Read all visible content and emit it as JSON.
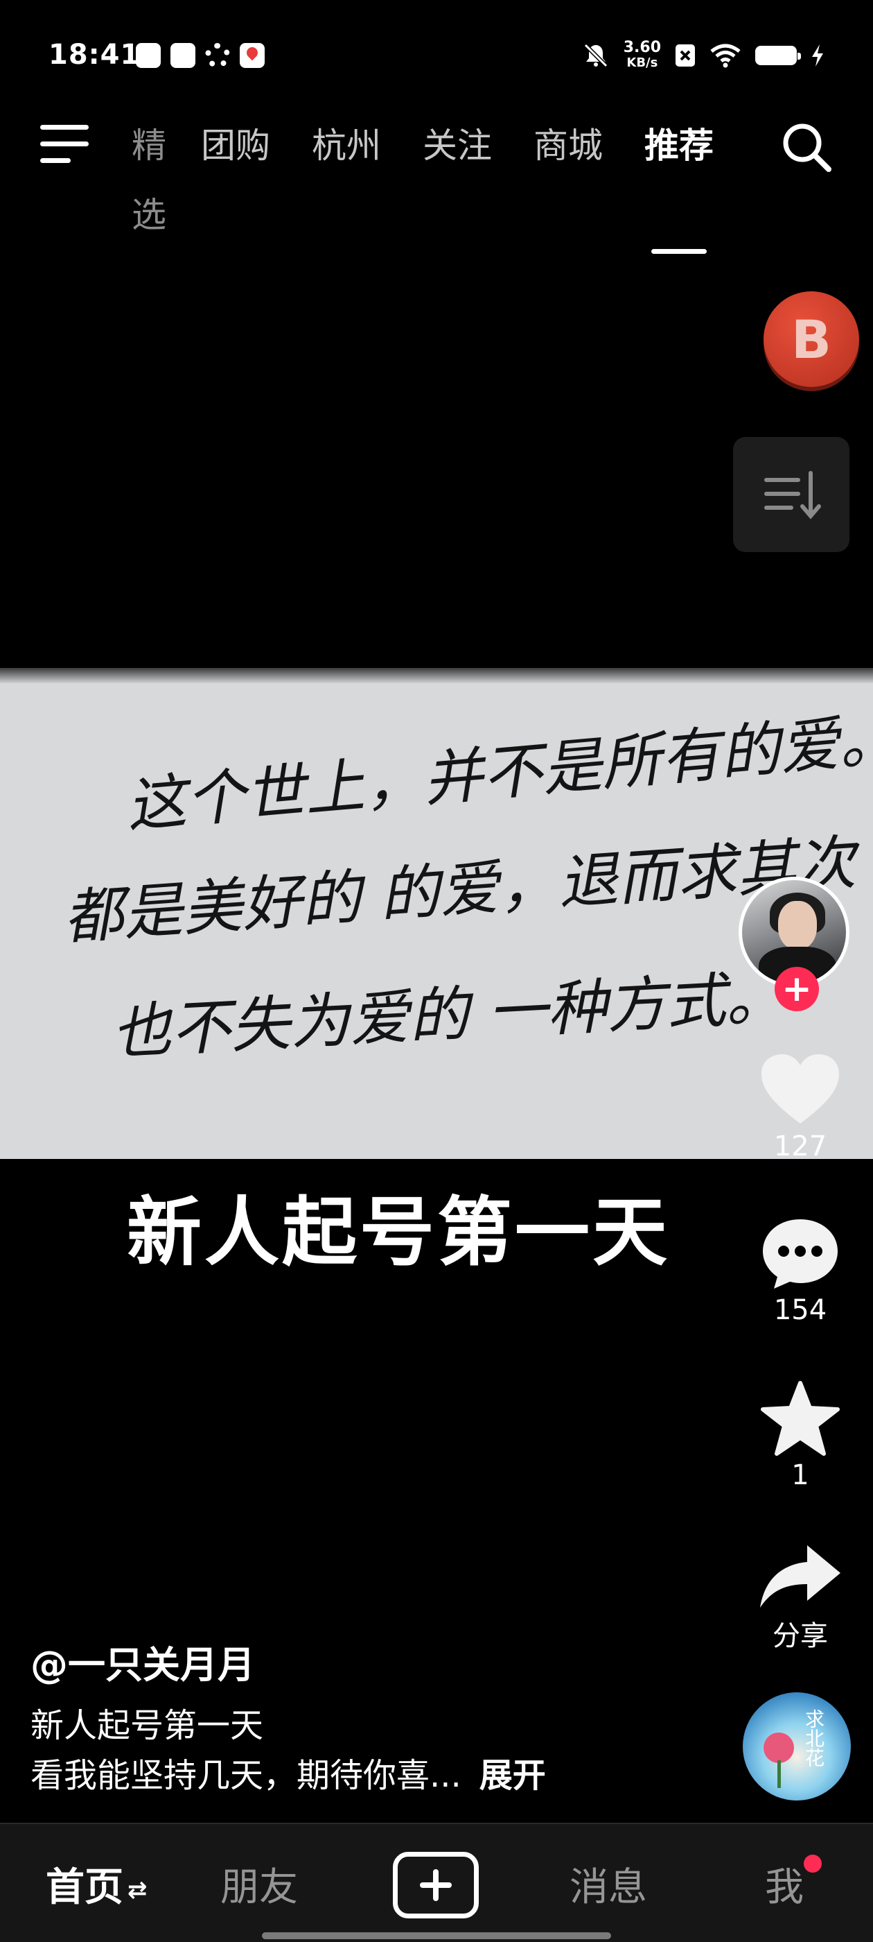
{
  "status_bar": {
    "time": "18:41",
    "net_speed_value": "3.60",
    "net_speed_unit": "KB/s",
    "icons": [
      "message-app-icon",
      "usb-icon",
      "settings-gear-icon",
      "map-pin-icon",
      "mute-bell-icon",
      "sim-off-icon",
      "wifi-icon",
      "battery-icon",
      "charging-bolt-icon"
    ]
  },
  "top_nav": {
    "tabs": [
      {
        "label": "精选",
        "state": "faded"
      },
      {
        "label": "团购",
        "state": "normal"
      },
      {
        "label": "杭州",
        "state": "normal"
      },
      {
        "label": "关注",
        "state": "normal"
      },
      {
        "label": "商城",
        "state": "normal"
      },
      {
        "label": "推荐",
        "state": "active"
      }
    ]
  },
  "floating": {
    "badge_letter": "B"
  },
  "video": {
    "handwriting_lines": [
      "这个世上，并不是所有的爱。",
      "都是美好的 的爱，退而求其次",
      "也不失为爱的 一种方式。"
    ],
    "caption": "新人起号第一天"
  },
  "actions": {
    "like_count": "127",
    "comment_count": "154",
    "favorite_count": "1",
    "share_label": "分享",
    "follow_symbol": "+"
  },
  "music": {
    "disc_text": "求北花"
  },
  "description": {
    "author": "@一只关月月",
    "title": "新人起号第一天",
    "line": "看我能坚持几天，期待你喜...",
    "expand_label": "展开"
  },
  "bottom_nav": {
    "home": "首页",
    "home_swap": "⇄",
    "friends": "朋友",
    "messages": "消息",
    "me": "我"
  },
  "colors": {
    "accent": "#fe2c55",
    "background": "#000000",
    "nav_bg": "#161616"
  }
}
